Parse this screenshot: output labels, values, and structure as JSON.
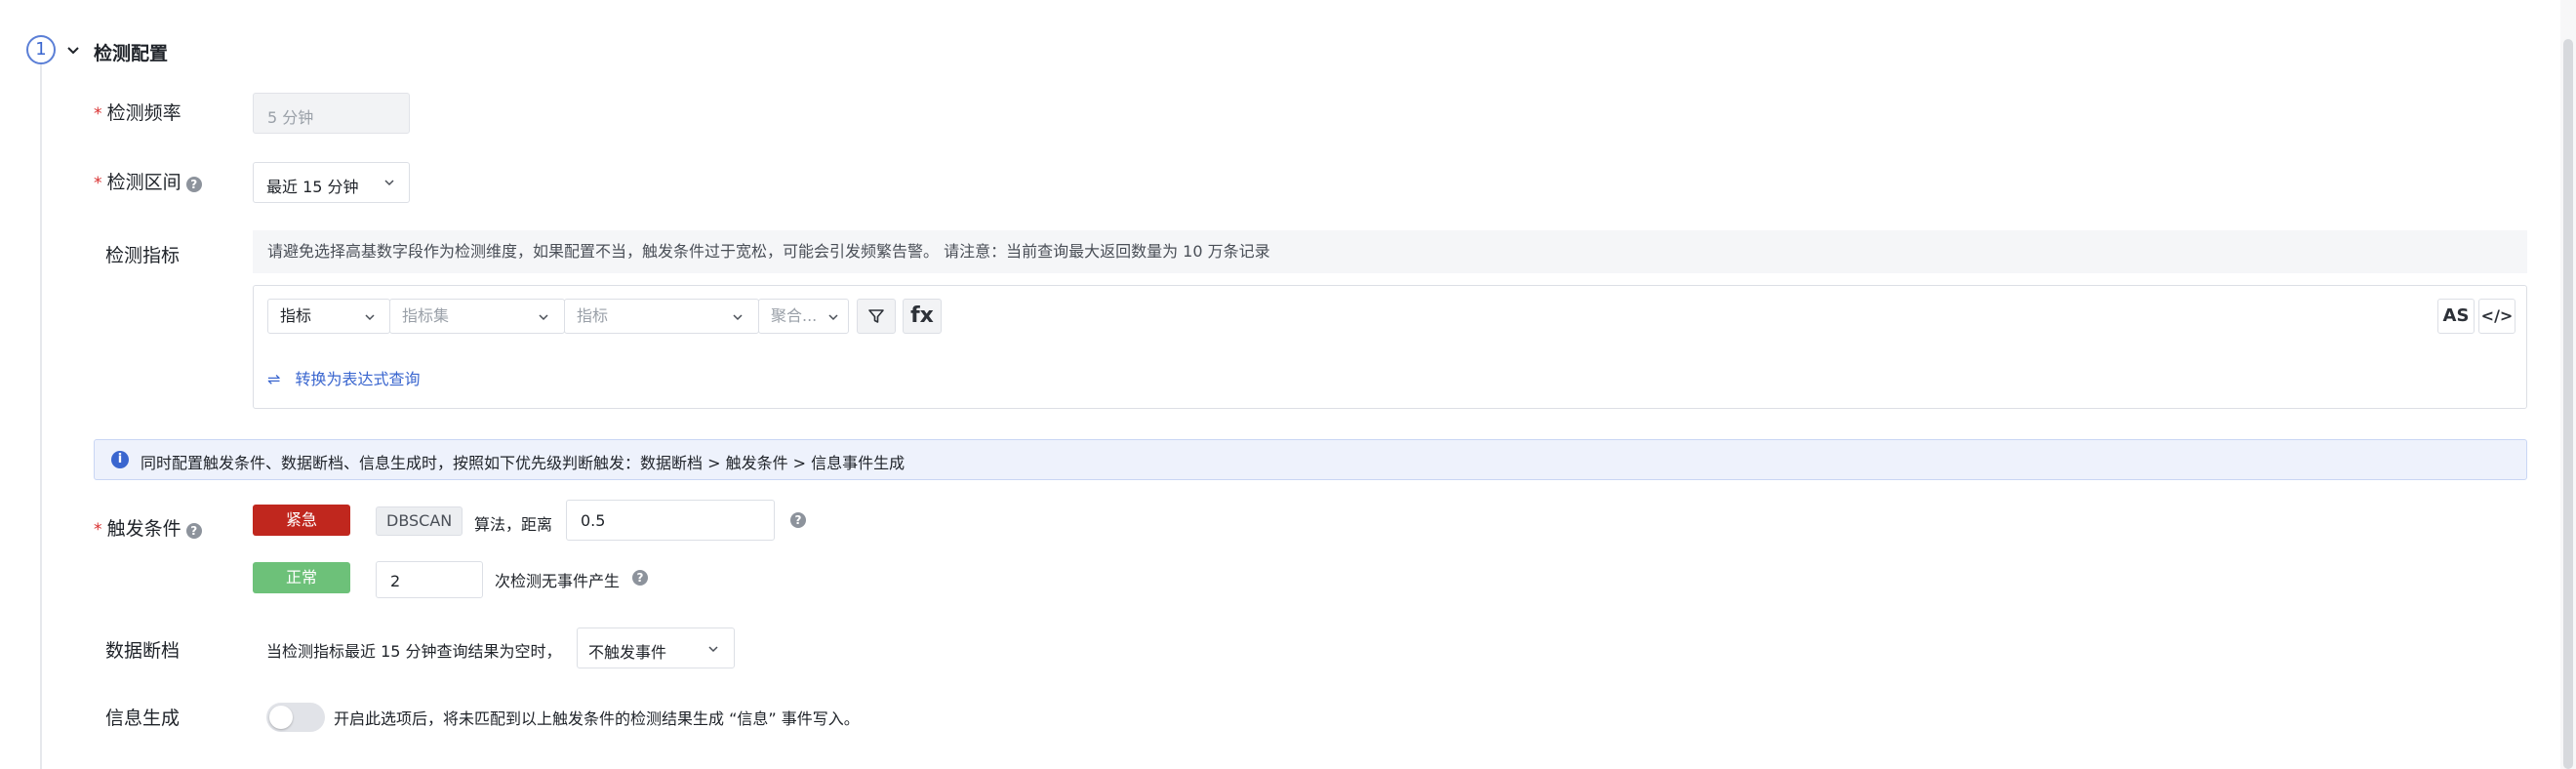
{
  "section": {
    "step_number": "1",
    "title": "检测配置"
  },
  "fields": {
    "frequency": {
      "label": "检测频率",
      "value": "5 分钟"
    },
    "interval": {
      "label": "检测区间",
      "value": "最近 15 分钟"
    },
    "metrics": {
      "label": "检测指标",
      "notice": "请避免选择高基数字段作为检测维度，如果配置不当，触发条件过于宽松，可能会引发频繁告警。 请注意：当前查询最大返回数量为 10 万条记录",
      "type_select": "指标",
      "metric_set_placeholder": "指标集",
      "metric_placeholder": "指标",
      "aggregate_placeholder": "聚合...",
      "fx_label": "fx",
      "as_label": "AS",
      "code_label": "</>",
      "convert_link": "转换为表达式查询"
    },
    "priority_notice": "同时配置触发条件、数据断档、信息生成时，按照如下优先级判断触发：数据断档 > 触发条件 > 信息事件生成",
    "trigger": {
      "label": "触发条件",
      "urgent_badge": "紧急",
      "algorithm_tag": "DBSCAN",
      "algorithm_text": "算法，距离",
      "distance_value": "0.5",
      "normal_badge": "正常",
      "normal_count": "2",
      "normal_text": "次检测无事件产生"
    },
    "nodata": {
      "label": "数据断档",
      "text": "当检测指标最近 15 分钟查询结果为空时，",
      "select_value": "不触发事件"
    },
    "info_gen": {
      "label": "信息生成",
      "text": "开启此选项后，将未匹配到以上触发条件的检测结果生成 “信息” 事件写入。",
      "enabled": false
    }
  },
  "colors": {
    "accent": "#3a66cf",
    "urgent": "#c0271e",
    "normal": "#6dc179",
    "required": "#d92f2f"
  },
  "icons": [
    "chevron-down-icon",
    "help-icon",
    "filter-icon",
    "swap-icon",
    "info-icon",
    "code-icon"
  ]
}
